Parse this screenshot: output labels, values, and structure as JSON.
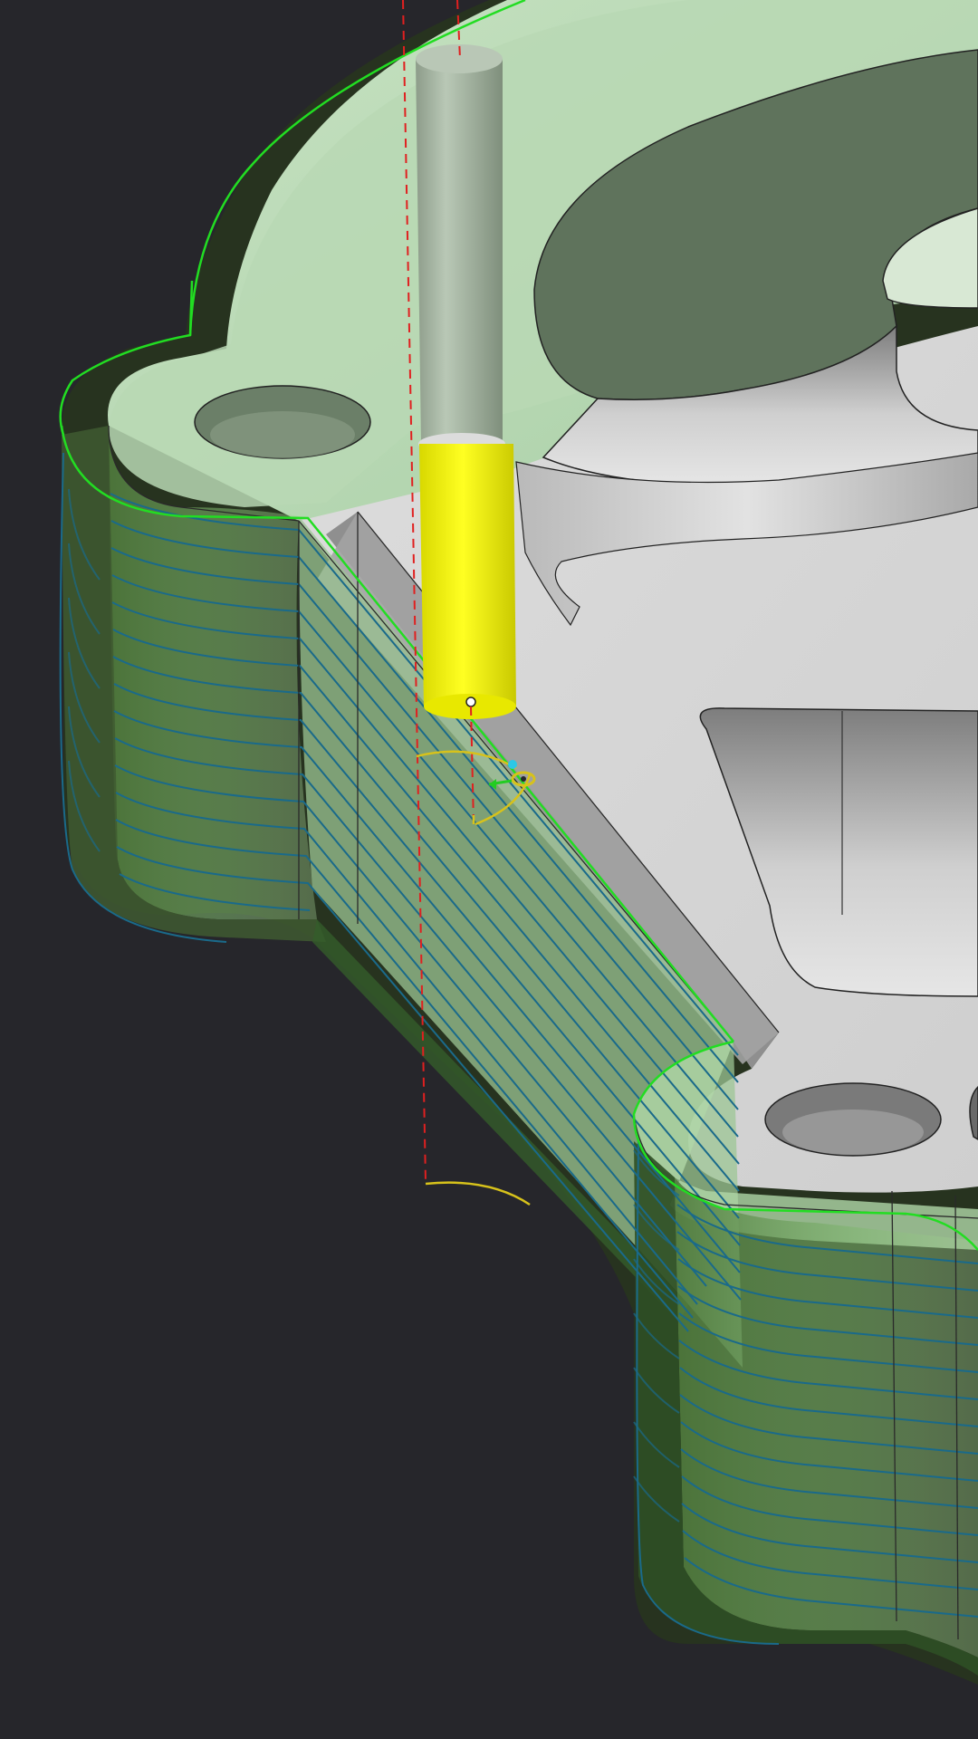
{
  "scene": {
    "kind": "cam-toolpath-viewport",
    "colors": {
      "background": "#26262b",
      "stock_green": "#a9cfa6",
      "part_gray": "#d6d6d6",
      "toolpath_blue": "#1a6a8a",
      "toolpath_green": "#22dd22",
      "tool_shank": "#a7b7a4",
      "tool_flute": "#f7f700",
      "guide_red": "#e02020",
      "arc_yellow": "#d7c21b",
      "tool_tip_cyan": "#2cc7e6"
    },
    "icons": {
      "tool": "cylindrical-end-mill-icon",
      "triad": "orientation-triad-icon",
      "tool_tip": "tool-tip-marker-icon"
    }
  }
}
